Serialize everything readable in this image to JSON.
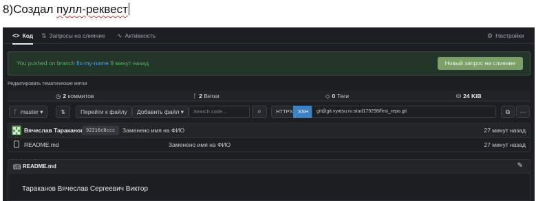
{
  "doc": {
    "heading_num": "8)",
    "heading_a": "Создал ",
    "heading_b": "пулл-реквест"
  },
  "nav": {
    "code": "Код",
    "pulls": "Запросы на слияние",
    "activity": "Активность",
    "settings": "Настройки"
  },
  "banner": {
    "prefix": "You pushed on branch",
    "branch": "fix-my-name",
    "suffix": "9 минут назад",
    "button": "Новый запрос на слияние"
  },
  "topics": {
    "edit": "Редактировать тематические метки"
  },
  "stats": {
    "commits_num": "2",
    "commits_label": "коммитов",
    "branches_num": "2",
    "branches_label": "Ветки",
    "tags_num": "0",
    "tags_label": "Теги",
    "size": "24 KiB"
  },
  "toolbar": {
    "branch": "master",
    "goto_file": "Перейти к файлу",
    "add_file": "Добавить файл",
    "search_placeholder": "Search code...",
    "https": "HTTPS",
    "ssh": "SSH",
    "clone_url": "git@git.vyatsu.ru:stud179298/first_repo.git"
  },
  "commit": {
    "author": "Вячеслав Тараканов",
    "sha": "92316c8ccc",
    "message": "Заменено имя на ФИО",
    "time": "27 минут назад"
  },
  "files": [
    {
      "name": "README.md",
      "message": "Заменено имя на ФИО",
      "time": "27 минут назад"
    }
  ],
  "readme": {
    "title": "README.md",
    "content": "Тараканов Вячеслав Сергеевич Виктор"
  },
  "colors": {
    "accent": "#3f82c4",
    "banner_button": "#7ba068",
    "banner_text": "#5dad6a",
    "background": "#1c1e21"
  }
}
